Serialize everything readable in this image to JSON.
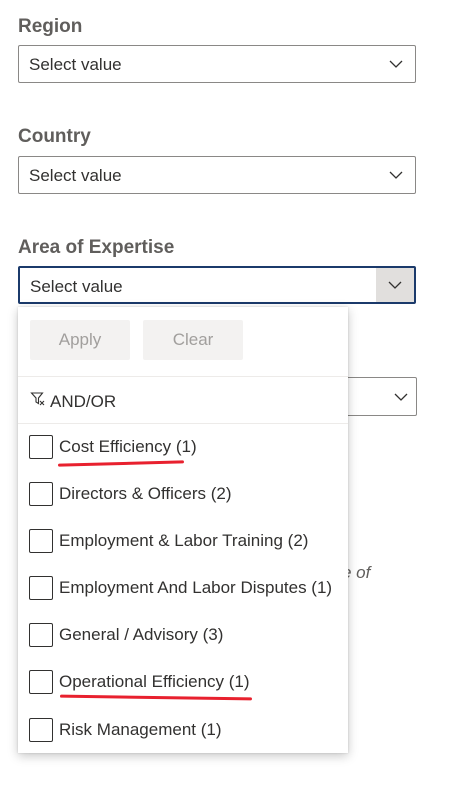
{
  "filters": {
    "region": {
      "label": "Region",
      "value": "Select value"
    },
    "country": {
      "label": "Country",
      "value": "Select value"
    },
    "expertise": {
      "label": "Area of Expertise",
      "value": "Select value"
    }
  },
  "background_fragment": "e of",
  "dropdown": {
    "apply_label": "Apply",
    "clear_label": "Clear",
    "andor_label": "AND/OR",
    "options": [
      {
        "label": "Cost Efficiency (1)",
        "checked": false
      },
      {
        "label": "Directors & Officers (2)",
        "checked": false
      },
      {
        "label": "Employment & Labor Training (2)",
        "checked": false
      },
      {
        "label": "Employment And Labor Disputes (1)",
        "checked": false
      },
      {
        "label": "General / Advisory (3)",
        "checked": false
      },
      {
        "label": "Operational Efficiency (1)",
        "checked": false
      },
      {
        "label": "Risk Management (1)",
        "checked": false
      }
    ]
  },
  "annotation_color": "#e8212e"
}
